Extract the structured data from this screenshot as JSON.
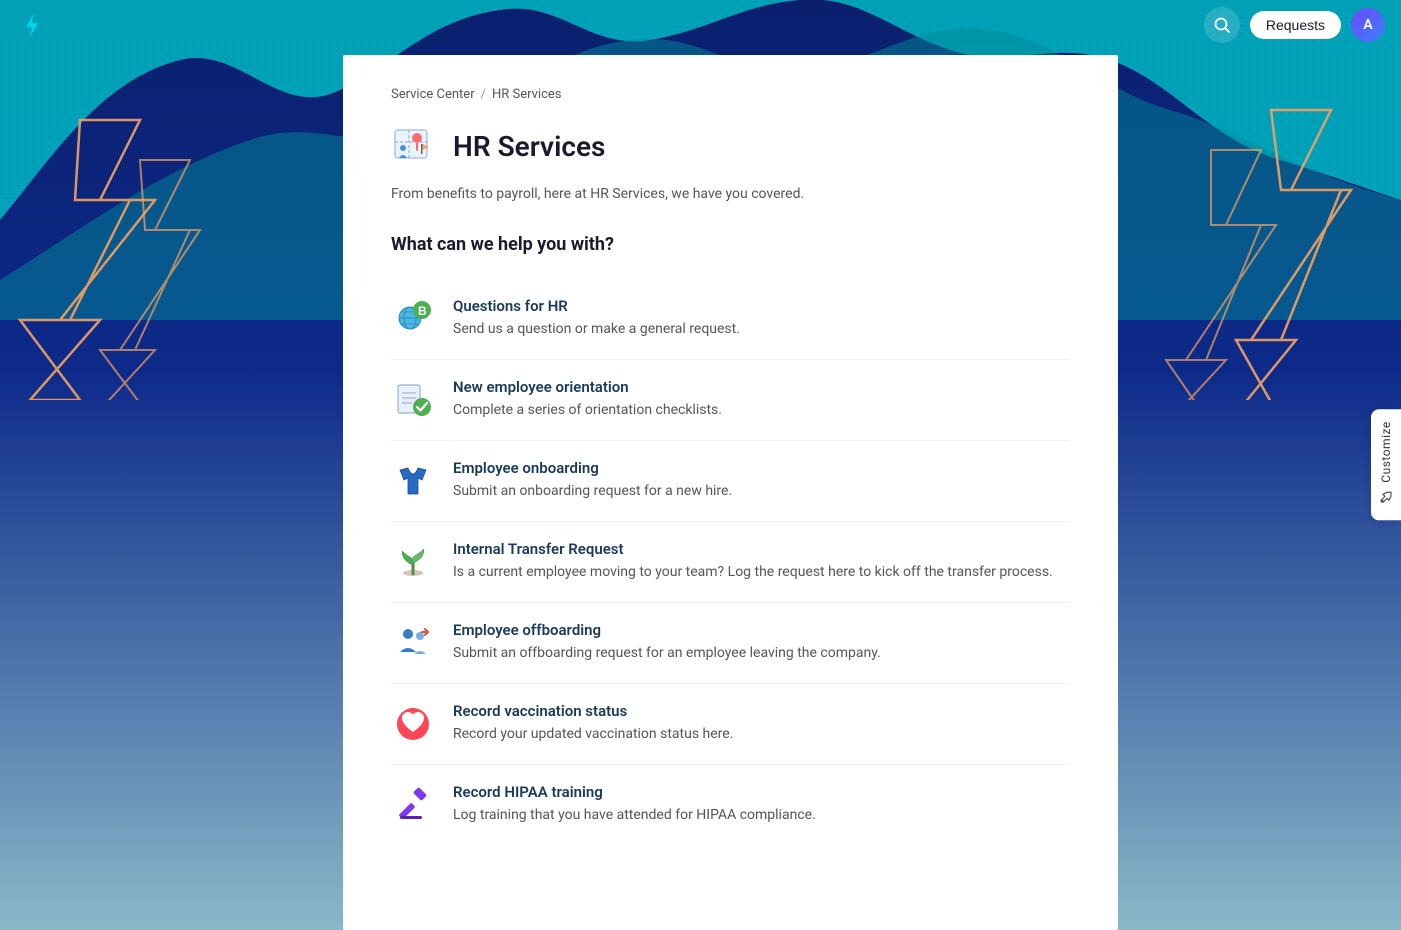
{
  "app": {
    "logo_label": "⚡",
    "nav_requests_label": "Requests",
    "nav_user_initials": "A",
    "customize_label": "Customize"
  },
  "breadcrumb": {
    "root": "Service Center",
    "separator": "/",
    "current": "HR Services"
  },
  "page": {
    "title": "HR Services",
    "description": "From benefits to payroll, here at HR Services, we have you covered.",
    "section_heading": "What can we help you with?"
  },
  "services": [
    {
      "id": "questions-hr",
      "title": "Questions for HR",
      "description": "Send us a question or make a general request.",
      "icon_type": "questions"
    },
    {
      "id": "new-employee-orientation",
      "title": "New employee orientation",
      "description": "Complete a series of orientation checklists.",
      "icon_type": "orientation"
    },
    {
      "id": "employee-onboarding",
      "title": "Employee onboarding",
      "description": "Submit an onboarding request for a new hire.",
      "icon_type": "onboarding"
    },
    {
      "id": "internal-transfer",
      "title": "Internal Transfer Request",
      "description": "Is a current employee moving to your team? Log the request here to kick off the transfer process.",
      "icon_type": "transfer"
    },
    {
      "id": "employee-offboarding",
      "title": "Employee offboarding",
      "description": "Submit an offboarding request for an employee leaving the company.",
      "icon_type": "offboarding"
    },
    {
      "id": "vaccination-status",
      "title": "Record vaccination status",
      "description": "Record your updated vaccination status here.",
      "icon_type": "vaccination"
    },
    {
      "id": "hipaa-training",
      "title": "Record HIPAA training",
      "description": "Log training that you have attended for HIPAA compliance.",
      "icon_type": "hipaa"
    }
  ]
}
